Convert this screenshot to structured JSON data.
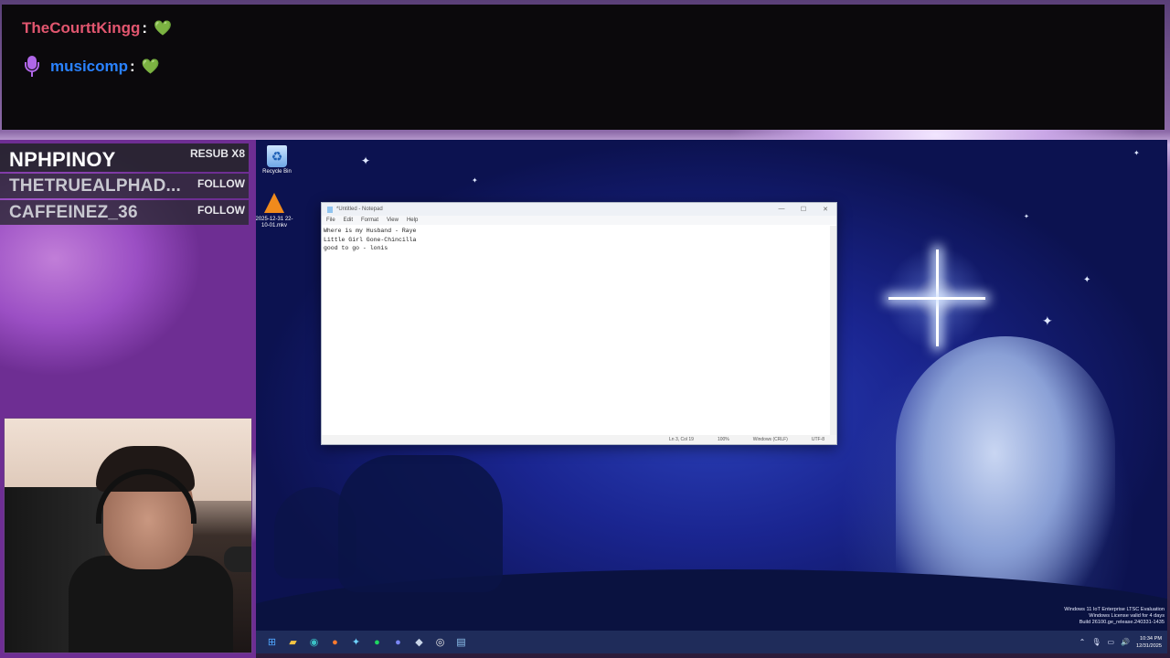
{
  "chat": {
    "messages": [
      {
        "user": "TheCourttKingg",
        "colon": ":",
        "emote": "💚"
      },
      {
        "user": "musicomp",
        "colon": ":",
        "emote": "💚"
      }
    ]
  },
  "alerts": [
    {
      "name": "NPHPINOY",
      "tag": "RESUB X8"
    },
    {
      "name": "THETRUEALPHAD...",
      "tag": "FOLLOW"
    },
    {
      "name": "CAFFEINEZ_36",
      "tag": "FOLLOW"
    }
  ],
  "desktop": {
    "icons": [
      {
        "label": "Recycle Bin",
        "icon": "recycle-bin-icon"
      },
      {
        "label": "2025-12-31 22-10-01.mkv",
        "icon": "vlc-icon"
      }
    ]
  },
  "notepad": {
    "title": "*Untitled - Notepad",
    "menu": [
      "File",
      "Edit",
      "Format",
      "View",
      "Help"
    ],
    "lines": [
      "Where is my Husband - Raye",
      "Little Girl Gone-Chincilla",
      "good to go - lonis"
    ],
    "status": {
      "position": "Ln 3, Col 19",
      "zoom": "100%",
      "line_ending": "Windows (CRLF)",
      "encoding": "UTF-8"
    }
  },
  "watermark": {
    "line1": "Windows 11 IoT Enterprise LTSC Evaluation",
    "line2": "Windows License valid for 4 days",
    "line3": "Build 26100.ge_release.240331-1435"
  },
  "taskbar": {
    "apps": [
      "start-icon",
      "file-explorer-icon",
      "edge-icon",
      "firefox-icon",
      "app-icon",
      "spotify-icon",
      "discord-icon",
      "steam-icon",
      "chrome-icon",
      "notepad-icon"
    ],
    "time": "10:34 PM",
    "date": "12/31/2025"
  }
}
